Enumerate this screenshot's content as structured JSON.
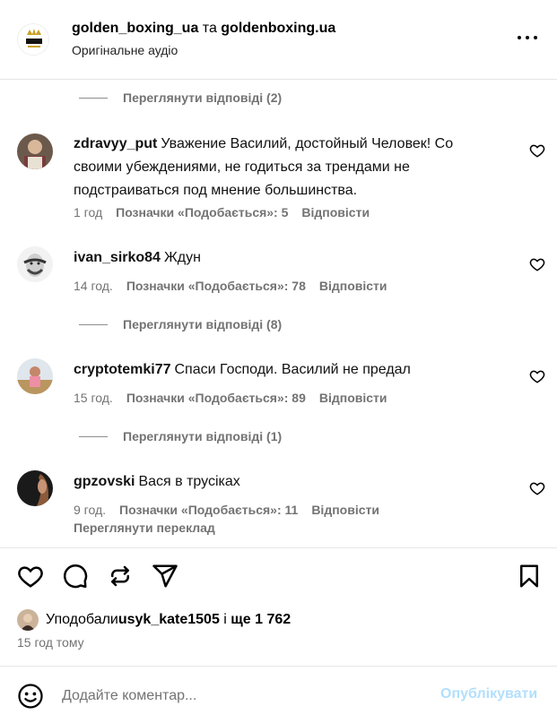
{
  "header": {
    "author1": "golden_boxing_ua",
    "connector": " та ",
    "author2": "goldenboxing.ua",
    "subtitle": "Оригінальне аудіо",
    "logo_text": "BOXING"
  },
  "view_replies": [
    "Переглянути відповіді (2)",
    "Переглянути відповіді (8)",
    "Переглянути відповіді (1)"
  ],
  "comments": [
    {
      "user": "zdravyy_put",
      "text": "Уважение Василий, достойный Человек! Со своими убеждениями, не годиться за трендами не подстраиваться под мнение большинства.",
      "time": "1 год",
      "likes": "Позначки «Подобається»: 5",
      "reply": "Відповісти"
    },
    {
      "user": "ivan_sirko84",
      "text": "Ждун",
      "time": "14 год.",
      "likes": "Позначки «Подобається»: 78",
      "reply": "Відповісти"
    },
    {
      "user": "cryptotemki77",
      "text": "Спаси Господи. Василий не предал",
      "time": "15 год.",
      "likes": "Позначки «Подобається»: 89",
      "reply": "Відповісти"
    },
    {
      "user": "gpzovski",
      "text": "Вася в трусіках",
      "time": "9 год.",
      "likes": "Позначки «Подобається»: 11",
      "reply": "Відповісти",
      "translate": "Переглянути переклад"
    }
  ],
  "likes_summary": {
    "prefix": "Уподобали ",
    "user": "usyk_kate1505",
    "middle": " і ",
    "count": "ще 1 762"
  },
  "time_ago": "15 год тому",
  "comment_box": {
    "placeholder": "Додайте коментар...",
    "publish": "Опублікувати"
  },
  "colors": {
    "secondary_text": "#737373",
    "publish_disabled": "#b2dffc",
    "divider": "#e6e6e6"
  },
  "icons": [
    "more-icon",
    "heart-icon",
    "comment-icon",
    "repost-icon",
    "share-icon",
    "bookmark-icon",
    "emoji-icon"
  ]
}
